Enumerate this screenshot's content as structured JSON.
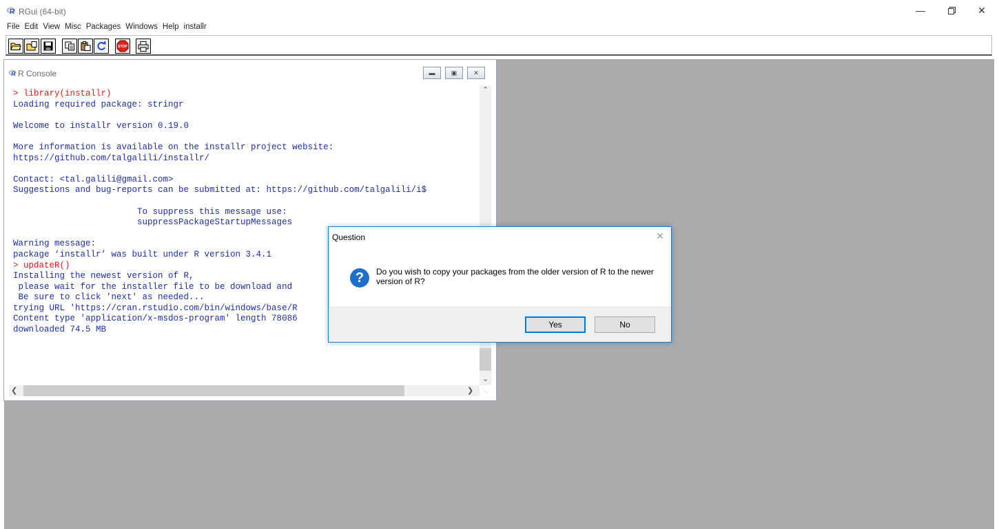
{
  "app": {
    "title": "RGui (64-bit)"
  },
  "menu": [
    "File",
    "Edit",
    "View",
    "Misc",
    "Packages",
    "Windows",
    "Help",
    "installr"
  ],
  "toolbar": {
    "buttons": [
      "open-script-icon",
      "load-workspace-icon",
      "save-workspace-icon",
      "copy-icon",
      "paste-icon",
      "copy-paste-icon",
      "stop-icon",
      "print-icon"
    ]
  },
  "console": {
    "title": "R Console",
    "lines": [
      {
        "text": "> library(installr)",
        "type": "command"
      },
      {
        "text": "Loading required package: stringr",
        "type": "output"
      },
      {
        "text": "",
        "type": "output"
      },
      {
        "text": "Welcome to installr version 0.19.0",
        "type": "output"
      },
      {
        "text": "",
        "type": "output"
      },
      {
        "text": "More information is available on the installr project website:",
        "type": "output"
      },
      {
        "text": "https://github.com/talgalili/installr/",
        "type": "output"
      },
      {
        "text": "",
        "type": "output"
      },
      {
        "text": "Contact: <tal.galili@gmail.com>",
        "type": "output"
      },
      {
        "text": "Suggestions and bug-reports can be submitted at: https://github.com/talgalili/i$",
        "type": "output"
      },
      {
        "text": "",
        "type": "output"
      },
      {
        "text": "                        To suppress this message use:",
        "type": "output"
      },
      {
        "text": "                        suppressPackageStartupMessages",
        "type": "output"
      },
      {
        "text": "",
        "type": "output"
      },
      {
        "text": "Warning message:",
        "type": "output"
      },
      {
        "text": "package ‘installr’ was built under R version 3.4.1",
        "type": "output"
      },
      {
        "text": "> updateR()",
        "type": "command"
      },
      {
        "text": "Installing the newest version of R,",
        "type": "output"
      },
      {
        "text": " please wait for the installer file to be download and",
        "type": "output"
      },
      {
        "text": " Be sure to click 'next' as needed...",
        "type": "output"
      },
      {
        "text": "trying URL 'https://cran.rstudio.com/bin/windows/base/R",
        "type": "output"
      },
      {
        "text": "Content type 'application/x-msdos-program' length 78086",
        "type": "output"
      },
      {
        "text": "downloaded 74.5 MB",
        "type": "output"
      }
    ]
  },
  "dialog": {
    "title": "Question",
    "message": "Do you wish to copy your packages from the older version of R to the newer version of R?",
    "yes_label": "Yes",
    "no_label": "No"
  },
  "colors": {
    "command": "#e8161b",
    "output": "#1f2da8",
    "mdi_background": "#ababab",
    "dialog_accent": "#0078d7"
  }
}
